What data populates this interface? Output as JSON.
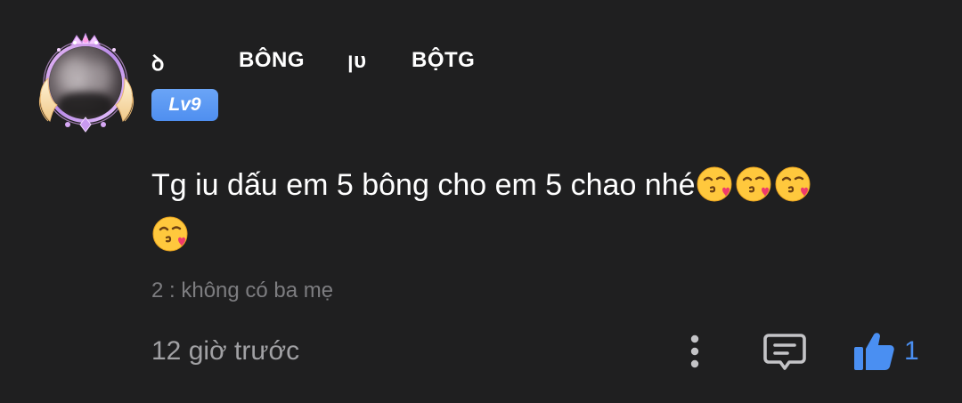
{
  "comment": {
    "author": {
      "name_parts": [
        "ꝺ",
        "BÔNG",
        "ꞁᴜ",
        "BỘTG"
      ],
      "level": "Lv9"
    },
    "text": "Tg iu dấu em 5 bông cho em 5 chao nhé",
    "emoji_icons": [
      "face-blowing-kiss-icon",
      "face-blowing-kiss-icon",
      "face-blowing-kiss-icon",
      "face-blowing-kiss-icon"
    ],
    "reply_reference": "2 : không có ba mẹ",
    "timestamp": "12 giờ trước",
    "like_count": "1"
  },
  "colors": {
    "background": "#1f1f20",
    "accent_blue": "#4a8ff2",
    "secondary_text": "#a1a1a4",
    "muted_text": "#7d7d80"
  }
}
